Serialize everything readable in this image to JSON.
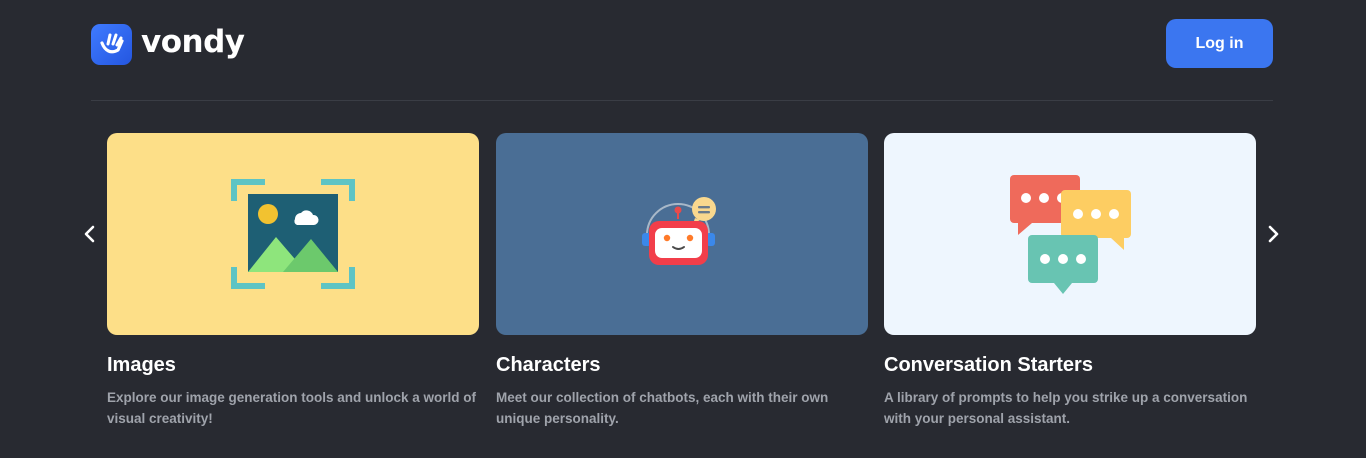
{
  "header": {
    "brand": "vondy",
    "login_label": "Log in"
  },
  "colors": {
    "background": "#282a31",
    "accent": "#3b76f0",
    "card_images": "#fddf88",
    "card_characters": "#4a6e95",
    "card_conversation": "#eef6fe"
  },
  "carousel": {
    "prev_icon": "chevron-left-icon",
    "next_icon": "chevron-right-icon",
    "cards": [
      {
        "title": "Images",
        "description": "Explore our image generation tools and unlock a world of visual creativity!",
        "icon": "image-gallery-icon"
      },
      {
        "title": "Characters",
        "description": "Meet our collection of chatbots, each with their own unique personality.",
        "icon": "robot-chat-icon"
      },
      {
        "title": "Conversation Starters",
        "description": "A library of prompts to help you strike up a conversation with your personal assistant.",
        "icon": "chat-bubbles-icon"
      }
    ]
  }
}
